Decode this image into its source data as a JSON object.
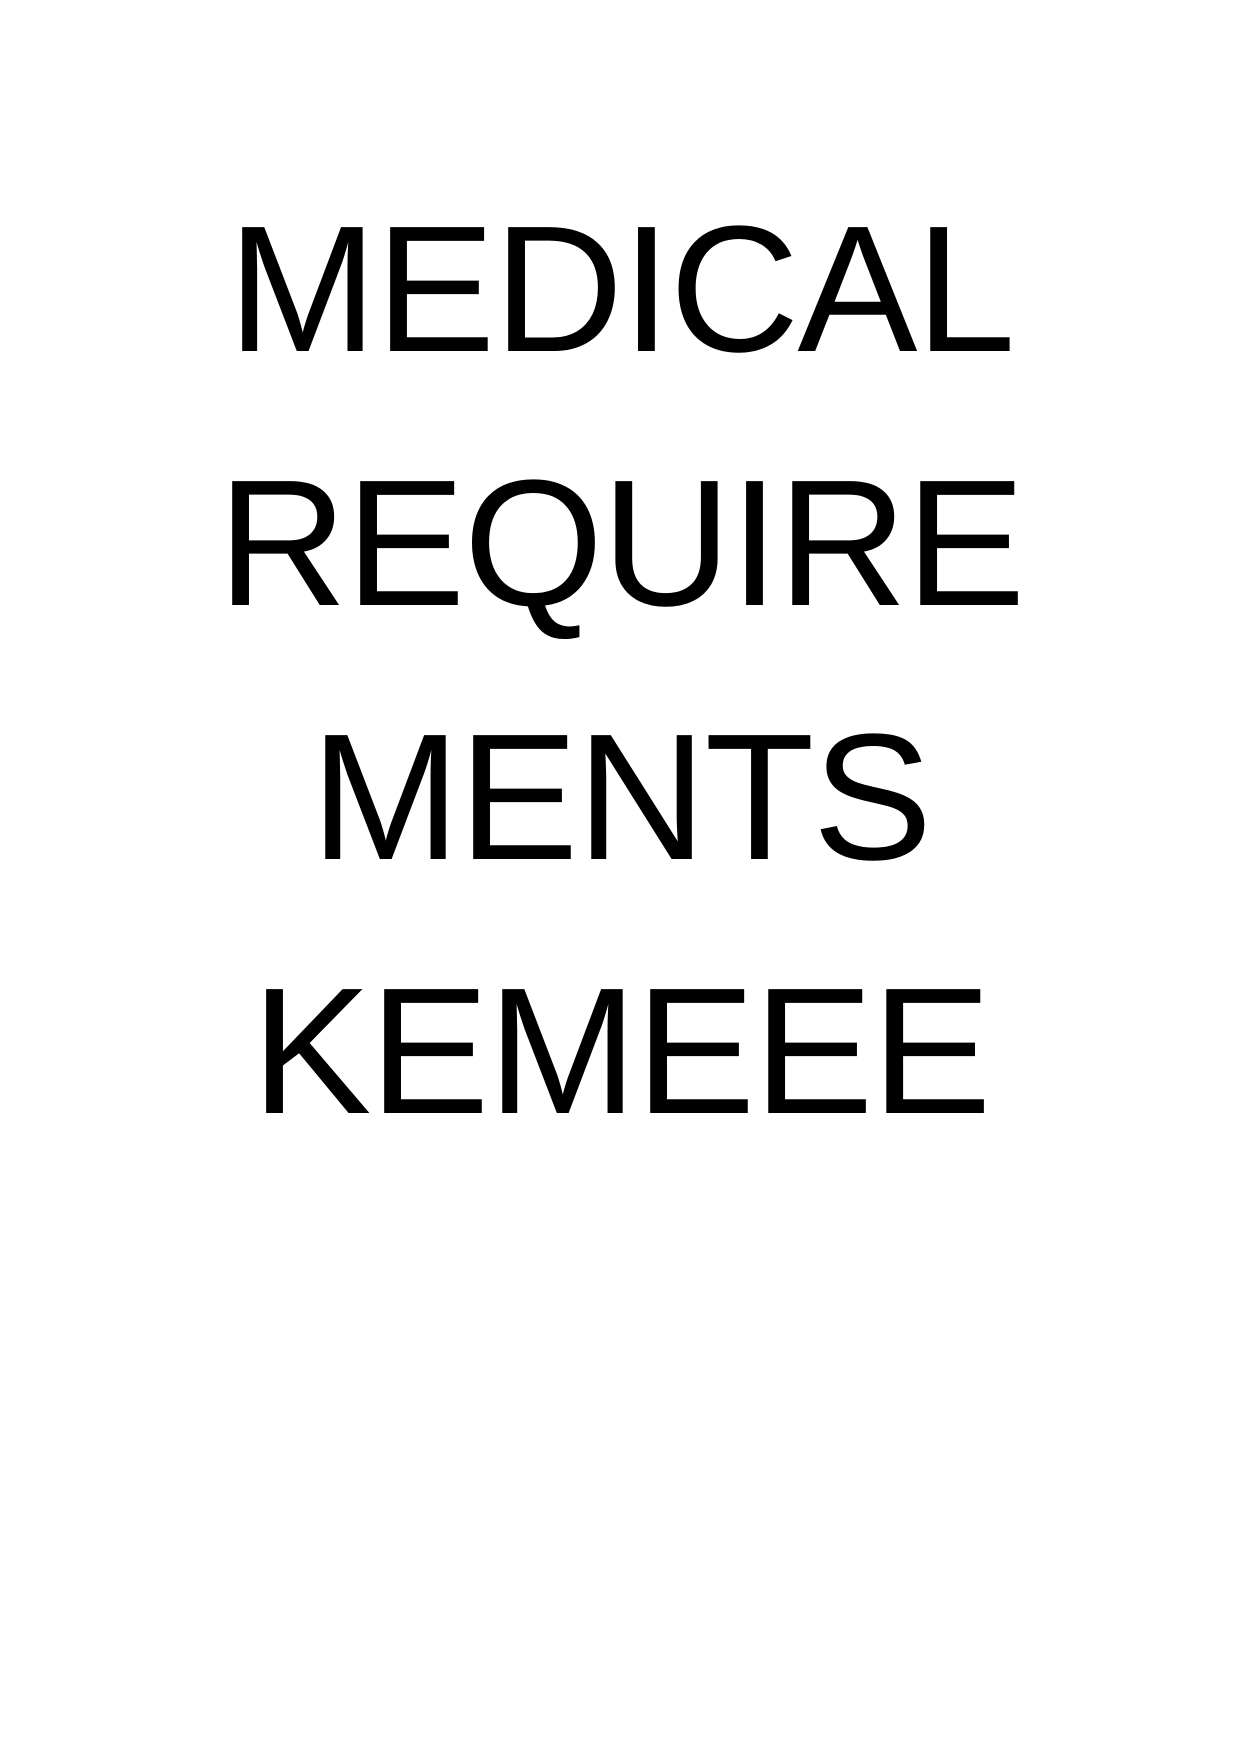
{
  "document": {
    "lines": [
      "MEDICAL",
      "REQUIRE",
      "MENTS",
      "KEMEEE"
    ]
  }
}
